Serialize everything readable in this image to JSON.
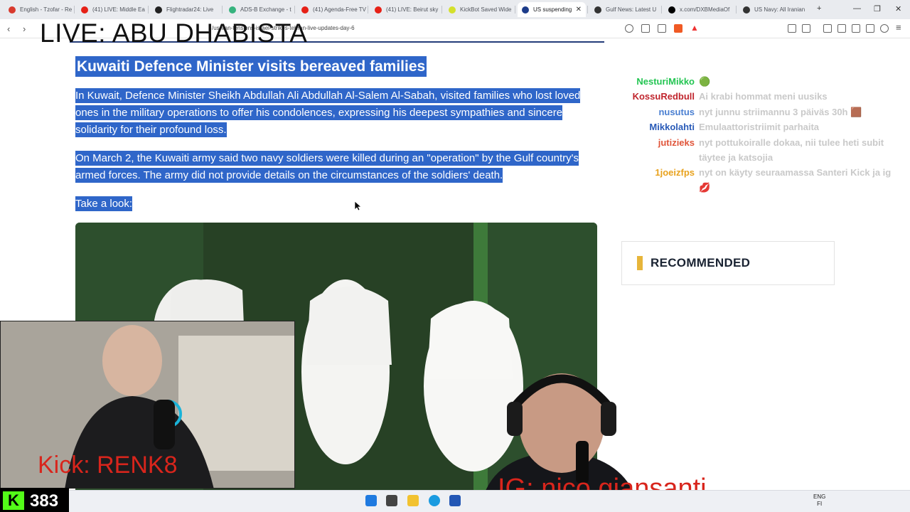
{
  "browser": {
    "tabs": [
      {
        "title": "English - Tzofar - Re",
        "color": "#d83a2e"
      },
      {
        "title": "(41) LIVE: Middle Ea",
        "color": "#e62117"
      },
      {
        "title": "Flightradar24: Live",
        "color": "#222222"
      },
      {
        "title": "ADS-B Exchange - t",
        "color": "#36b37e"
      },
      {
        "title": "(41) Agenda-Free TV",
        "color": "#e62117"
      },
      {
        "title": "(41) LIVE: Beirut sky",
        "color": "#e62117"
      },
      {
        "title": "KickBot Saved Wide",
        "color": "#d4e02c"
      },
      {
        "title": "US suspending",
        "color": "#1d3c8a"
      },
      {
        "title": "Gulf News: Latest U",
        "color": "#333333"
      },
      {
        "title": "x.com/DXBMediaOf",
        "color": "#000000"
      },
      {
        "title": "US Navy: All Iranian",
        "color": "#333333"
      }
    ],
    "active_tab_index": 7,
    "new_tab_symbol": "+",
    "close_symbol": "✕",
    "url": "/us-iran-tensions-israel-strikes-tehran-live-updates-day-6"
  },
  "overlay": {
    "live_title": "LIVE: ABU DHABISTA",
    "kick_label": "Kick: RENK8",
    "ig_label": "IG: nico.giansanti",
    "kick_count": "383"
  },
  "article": {
    "headline": "Kuwaiti Defence Minister visits bereaved families",
    "paragraphs": [
      "In Kuwait, Defence Minister Sheikh Abdullah Ali Abdullah Al-Salem Al-Sabah, visited families who lost loved ones in the military operations to offer his condolences, expressing his deepest sympathies and sincere solidarity for their profound loss.",
      "On March 2, the Kuwaiti army said two navy soldiers were killed during an \"operation\" by the Gulf country's armed forces. The army did not provide details on the circumstances of the soldiers' death."
    ],
    "take_look": "Take a look:"
  },
  "chat": [
    {
      "user": "NesturiMikko",
      "color": "#23c552",
      "message": "🟢"
    },
    {
      "user": "KossuRedbull",
      "color": "#c0252d",
      "message": "Ai krabi hommat meni uusiks"
    },
    {
      "user": "nusutus",
      "color": "#4a7fd1",
      "message": "nyt junnu striimannu 3 päiväs 30h 🟫"
    },
    {
      "user": "Mikkolahti",
      "color": "#2a5bb8",
      "message": "Emulaattoristriimit parhaita"
    },
    {
      "user": "jutizieks",
      "color": "#e0553a",
      "message": "nyt pottukoiralle dokaa, nii tulee heti subit täytee ja katsojia"
    },
    {
      "user": "1joeizfps",
      "color": "#e8a21e",
      "message": "nyt on käyty seuraamassa Santeri Kick ja ig 💋"
    }
  ],
  "recommended": {
    "title": "RECOMMENDED"
  },
  "taskbar": {
    "lang_top": "ENG",
    "lang_bottom": "FI"
  }
}
